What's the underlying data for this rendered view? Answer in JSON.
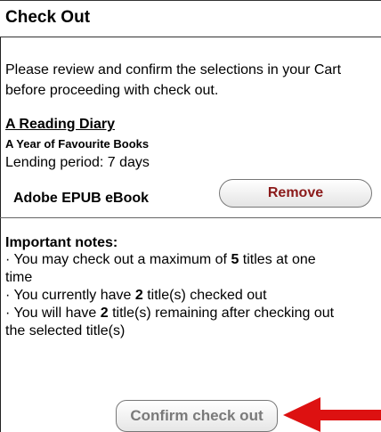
{
  "header": {
    "title": "Check Out"
  },
  "intro": {
    "line1": "Please review and confirm the selections in your Cart",
    "line2": "before proceeding with check out."
  },
  "item": {
    "title": "A Reading Diary",
    "subtitle": "A Year of Favourite Books",
    "lending_period": "Lending period: 7 days",
    "format": "Adobe EPUB eBook",
    "remove_label": "Remove"
  },
  "notes": {
    "title": "Important notes:",
    "line1_pre": "· You may check out a maximum of ",
    "line1_num": "5",
    "line1_post": " titles at one",
    "line2": "time",
    "line3_pre": "· You currently have ",
    "line3_num": "2",
    "line3_post": " title(s) checked out",
    "line4_pre": "· You will have ",
    "line4_num": "2",
    "line4_post": " title(s) remaining after checking out",
    "line5": "the selected title(s)"
  },
  "actions": {
    "confirm_label": "Confirm check out"
  },
  "colors": {
    "remove_text": "#8b1a1a",
    "arrow": "#dd1111",
    "confirm_text": "#7a7a7a"
  }
}
